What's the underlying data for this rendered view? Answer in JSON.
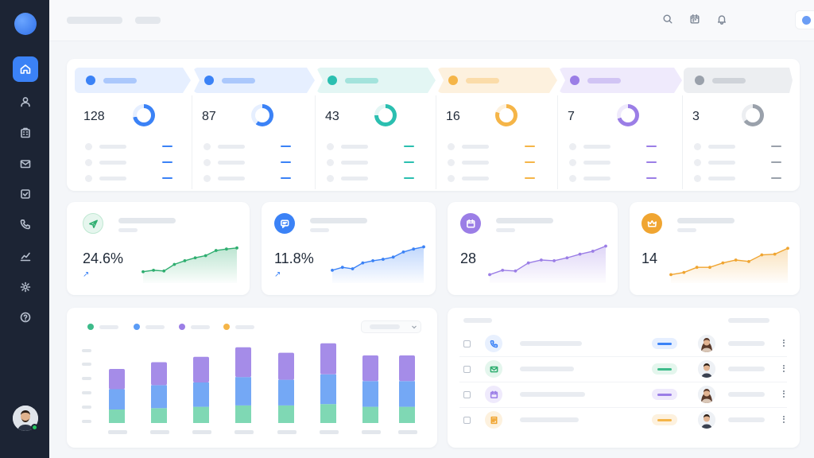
{
  "sidebar": {
    "items": [
      {
        "icon": "home-icon",
        "active": true
      },
      {
        "icon": "user-icon",
        "active": false
      },
      {
        "icon": "building-icon",
        "active": false
      },
      {
        "icon": "mail-icon",
        "active": false
      },
      {
        "icon": "checkbox-icon",
        "active": false
      },
      {
        "icon": "phone-icon",
        "active": false
      },
      {
        "icon": "analytics-icon",
        "active": false
      },
      {
        "icon": "gear-icon",
        "active": false
      },
      {
        "icon": "help-icon",
        "active": false
      }
    ],
    "accent": "#3b82f6",
    "background": "#1c2434"
  },
  "header": {
    "icons": [
      "search-icon",
      "calendar-icon",
      "bell-icon"
    ],
    "profile_dot_color": "#6b9df5"
  },
  "pipeline": {
    "stages": [
      {
        "color": "#3b82f6",
        "bg": "#e6efff",
        "count": "128",
        "ring_pct": 72
      },
      {
        "color": "#3b82f6",
        "bg": "#e6efff",
        "count": "87",
        "ring_pct": 60
      },
      {
        "color": "#2bbfb0",
        "bg": "#e3f6f4",
        "count": "43",
        "ring_pct": 75
      },
      {
        "color": "#f5b548",
        "bg": "#fdf1de",
        "count": "16",
        "ring_pct": 80
      },
      {
        "color": "#9b7ee6",
        "bg": "#efeafc",
        "count": "7",
        "ring_pct": 70
      },
      {
        "color": "#9aa1ab",
        "bg": "#eceef1",
        "count": "3",
        "ring_pct": 65
      }
    ]
  },
  "kpis": [
    {
      "value": "24.6%",
      "trend": "↗",
      "color": "#2fae70",
      "icon": "send-icon",
      "icon_bg": "#e6f6ee",
      "line": [
        0.18,
        0.22,
        0.2,
        0.38,
        0.48,
        0.56,
        0.62,
        0.76,
        0.8,
        0.83
      ]
    },
    {
      "value": "11.8%",
      "trend": "↗",
      "color": "#3b82f6",
      "icon": "chat-icon",
      "icon_bg": "#3b82f6",
      "line": [
        0.22,
        0.3,
        0.26,
        0.42,
        0.48,
        0.52,
        0.58,
        0.72,
        0.8,
        0.86
      ]
    },
    {
      "value": "28",
      "trend": "",
      "color": "#9b7ee6",
      "icon": "calendar-icon",
      "icon_bg": "#9b7ee6",
      "line": [
        0.1,
        0.22,
        0.2,
        0.42,
        0.5,
        0.48,
        0.56,
        0.66,
        0.74,
        0.88
      ]
    },
    {
      "value": "14",
      "trend": "",
      "color": "#f0a531",
      "icon": "crown-icon",
      "icon_bg": "#f0a531",
      "line": [
        0.1,
        0.16,
        0.3,
        0.3,
        0.42,
        0.5,
        0.46,
        0.64,
        0.66,
        0.82
      ]
    }
  ],
  "chart_data": {
    "type": "bar",
    "stacked": true,
    "series_colors": [
      "#7fd8b4",
      "#74a8f5",
      "#a58ce8"
    ],
    "legend_colors": [
      "#3dbb8a",
      "#5b9cf6",
      "#9b7ee6",
      "#f5b548"
    ],
    "values": [
      [
        0.2,
        0.3,
        0.3
      ],
      [
        0.22,
        0.34,
        0.34
      ],
      [
        0.24,
        0.36,
        0.38
      ],
      [
        0.26,
        0.42,
        0.44
      ],
      [
        0.26,
        0.38,
        0.4
      ],
      [
        0.28,
        0.44,
        0.46
      ],
      [
        0.24,
        0.38,
        0.38
      ],
      [
        0.24,
        0.38,
        0.38
      ]
    ],
    "grid": false
  },
  "table": {
    "rows": [
      {
        "icon": "phone-icon",
        "icon_bg": "#e8f0fe",
        "icon_color": "#3b82f6",
        "pill_color": "#3b82f6",
        "pill_bg": "#e6efff",
        "avatar": "female"
      },
      {
        "icon": "mail-icon",
        "icon_bg": "#e4f6ed",
        "icon_color": "#2fae70",
        "pill_color": "#3dbb8a",
        "pill_bg": "#e4f6ed",
        "avatar": "male"
      },
      {
        "icon": "calendar-icon",
        "icon_bg": "#efeafc",
        "icon_color": "#9b7ee6",
        "pill_color": "#9b7ee6",
        "pill_bg": "#efeafc",
        "avatar": "female"
      },
      {
        "icon": "note-icon",
        "icon_bg": "#fdf1de",
        "icon_color": "#f0a531",
        "pill_color": "#f5b548",
        "pill_bg": "#fdf1de",
        "avatar": "male"
      }
    ]
  }
}
